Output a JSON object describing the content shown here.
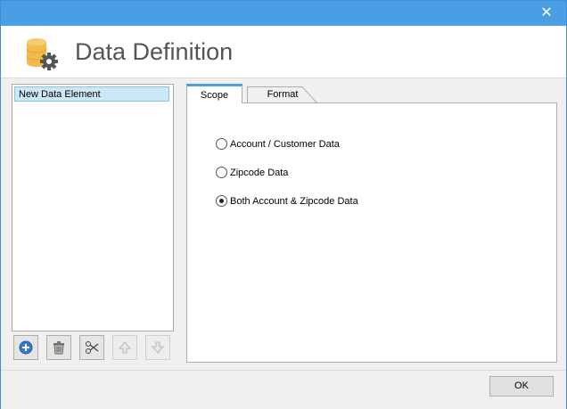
{
  "window": {
    "close_glyph": "✕"
  },
  "header": {
    "title": "Data Definition",
    "icon": "database-gear-icon"
  },
  "left_panel": {
    "items": [
      {
        "label": "New Data Element",
        "selected": true
      }
    ],
    "toolbar": [
      {
        "name": "add",
        "icon": "add-icon",
        "enabled": true
      },
      {
        "name": "delete",
        "icon": "trash-icon",
        "enabled": true
      },
      {
        "name": "cut",
        "icon": "scissors-icon",
        "enabled": true
      },
      {
        "name": "move-up",
        "icon": "arrow-up-icon",
        "enabled": false
      },
      {
        "name": "move-down",
        "icon": "arrow-down-icon",
        "enabled": false
      }
    ]
  },
  "tabs": [
    {
      "label": "Scope",
      "active": true
    },
    {
      "label": "Format",
      "active": false
    }
  ],
  "scope": {
    "options": [
      {
        "label": "Account / Customer Data",
        "checked": false
      },
      {
        "label": "Zipcode Data",
        "checked": false
      },
      {
        "label": "Both Account & Zipcode Data",
        "checked": true
      }
    ]
  },
  "footer": {
    "ok_label": "OK"
  },
  "colors": {
    "accent": "#4a9ee3",
    "selection": "#cce8f7",
    "icon_gold": "#f2bc4b",
    "icon_gear": "#555555"
  }
}
